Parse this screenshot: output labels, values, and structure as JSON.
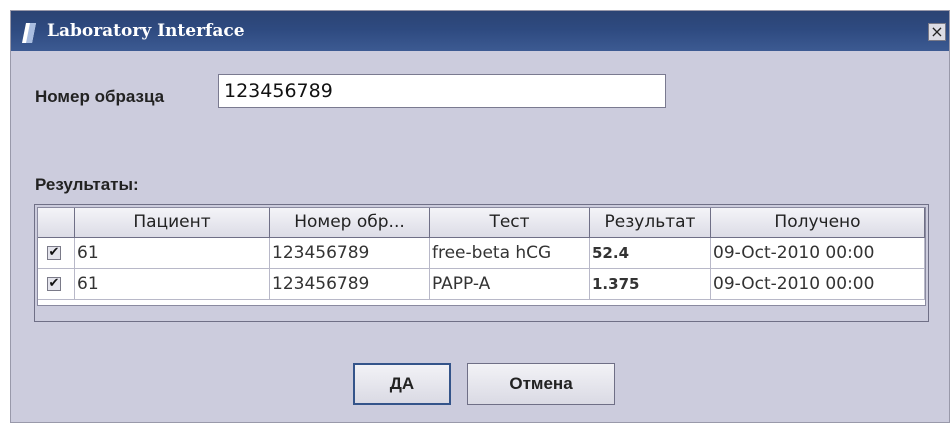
{
  "window": {
    "title": "Laboratory Interface",
    "close_label": "×"
  },
  "form": {
    "sample_label": "Номер образца",
    "sample_value": "123456789",
    "results_label": "Результаты:"
  },
  "table": {
    "columns": [
      "",
      "Пациент",
      "Номер обр...",
      "Тест",
      "Результат",
      "Получено"
    ],
    "rows": [
      {
        "checked": "✔",
        "patient": "61",
        "sample": "123456789",
        "test": "free-beta hCG",
        "result": "52.4",
        "received": "09-Oct-2010 00:00"
      },
      {
        "checked": "✔",
        "patient": "61",
        "sample": "123456789",
        "test": "PAPP-A",
        "result": "1.375",
        "received": "09-Oct-2010 00:00"
      }
    ]
  },
  "buttons": {
    "ok_label": "ДА",
    "cancel_label": "Отмена"
  },
  "colors": {
    "titlebar": "#2e4a80",
    "dialog_background": "#ccccdd"
  }
}
